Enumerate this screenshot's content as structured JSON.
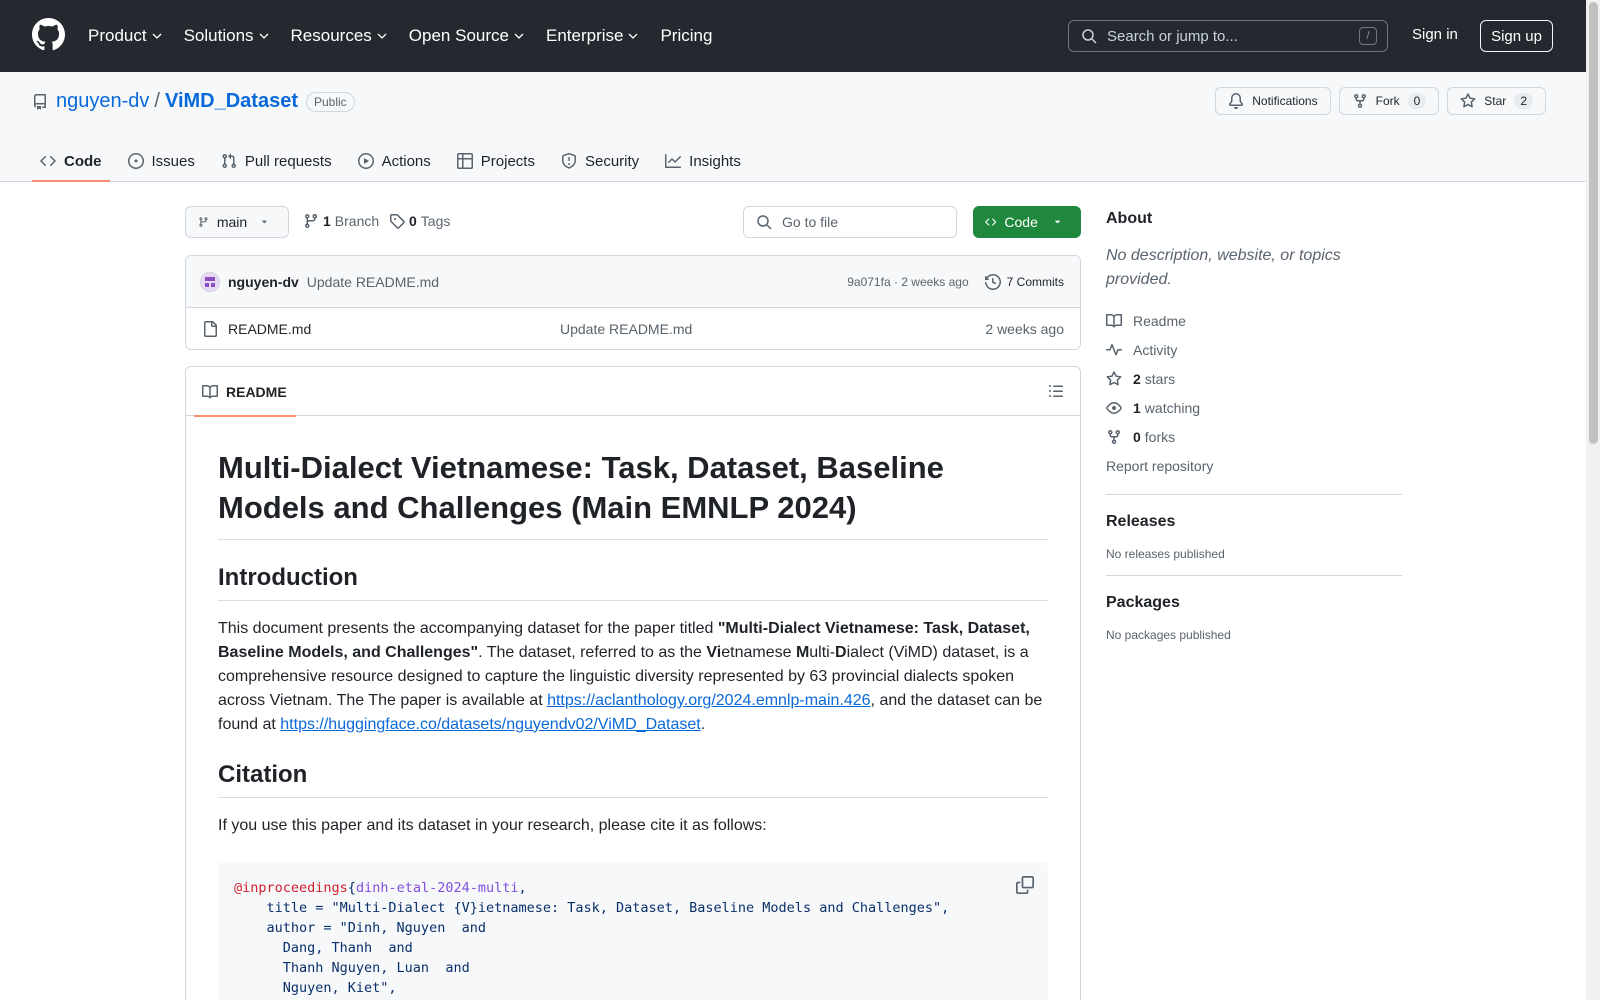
{
  "header": {
    "nav": [
      "Product",
      "Solutions",
      "Resources",
      "Open Source",
      "Enterprise",
      "Pricing"
    ],
    "search_placeholder": "Search or jump to...",
    "search_key": "/",
    "sign_in": "Sign in",
    "sign_up": "Sign up"
  },
  "repo": {
    "owner": "nguyen-dv",
    "separator": "/",
    "name": "ViMD_Dataset",
    "visibility": "Public",
    "notifications": "Notifications",
    "fork": "Fork",
    "fork_count": "0",
    "star": "Star",
    "star_count": "2",
    "tabs": [
      "Code",
      "Issues",
      "Pull requests",
      "Actions",
      "Projects",
      "Security",
      "Insights"
    ]
  },
  "toolbar": {
    "branch": "main",
    "branch_count": "1",
    "branch_label": "Branch",
    "tag_count": "0",
    "tag_label": "Tags",
    "goto_placeholder": "Go to file",
    "code_button": "Code"
  },
  "commit": {
    "author": "nguyen-dv",
    "message": "Update README.md",
    "hash_time": "9a071fa · 2 weeks ago",
    "commits": "7 Commits"
  },
  "files": [
    {
      "name": "README.md",
      "message": "Update README.md",
      "age": "2 weeks ago"
    }
  ],
  "readme": {
    "tab": "README",
    "title": "Multi-Dialect Vietnamese: Task, Dataset, Baseline Models and Challenges (Main EMNLP 2024)",
    "intro_heading": "Introduction",
    "intro_p1": "This document presents the accompanying dataset for the paper titled ",
    "intro_bold": "\"Multi-Dialect Vietnamese: Task, Dataset, Baseline Models, and Challenges\"",
    "intro_p2": ". The dataset, referred to as the ",
    "vi": "Vi",
    "intro_p3": "etnamese ",
    "m": "M",
    "intro_p4": "ulti-",
    "d": "D",
    "intro_p5": "ialect (ViMD) dataset, is a comprehensive resource designed to capture the linguistic diversity represented by 63 provincial dialects spoken across Vietnam. The The paper is available at ",
    "link1": "https://aclanthology.org/2024.emnlp-main.426",
    "intro_p6": ", and the dataset can be found at ",
    "link2": "https://huggingface.co/datasets/nguyendv02/ViMD_Dataset",
    "intro_end": ".",
    "citation_heading": "Citation",
    "citation_text": "If you use this paper and its dataset in your research, please cite it as follows:",
    "code_kw": "@inproceedings",
    "code_brace": "{",
    "code_key": "dinh-etal-2024-multi",
    "code_rest": ",\n    title = \"Multi-Dialect {V}ietnamese: Task, Dataset, Baseline Models and Challenges\",\n    author = \"Dinh, Nguyen  and\n      Dang, Thanh  and\n      Thanh Nguyen, Luan  and\n      Nguyen, Kiet\",\n    editor = \"Al-Onaizan, Yaser  and"
  },
  "sidebar": {
    "about": "About",
    "description": "No description, website, or topics provided.",
    "readme": "Readme",
    "activity": "Activity",
    "stars_count": "2",
    "stars": "stars",
    "watching_count": "1",
    "watching": "watching",
    "forks_count": "0",
    "forks": "forks",
    "report": "Report repository",
    "releases": "Releases",
    "no_releases": "No releases published",
    "packages": "Packages",
    "no_packages": "No packages published"
  }
}
